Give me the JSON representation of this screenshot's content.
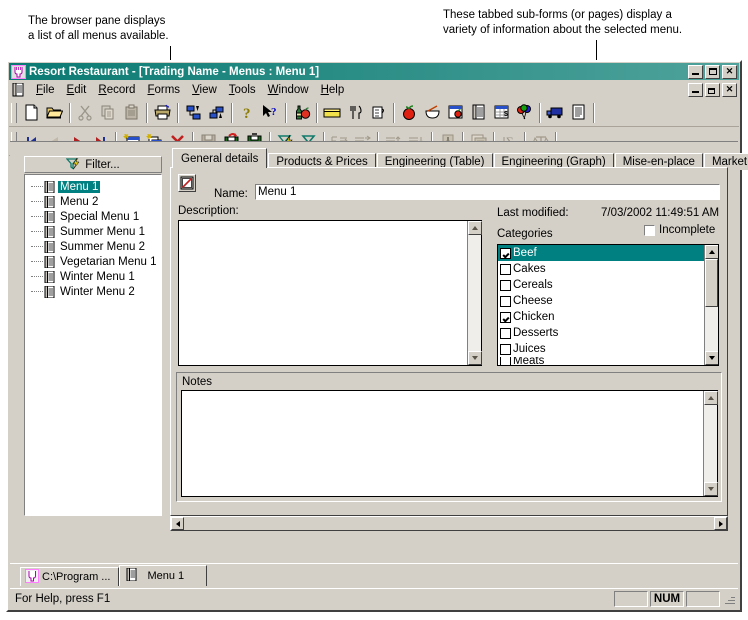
{
  "annotations": [
    {
      "text": "The browser pane displays\na list of all menus available.",
      "name": "callout-browser-pane"
    },
    {
      "text": "These tabbed sub-forms (or pages) display a\nvariety of information about the selected menu.",
      "name": "callout-tabbed-subforms"
    }
  ],
  "window": {
    "title": "Resort Restaurant - [Trading Name - Menus : Menu 1]",
    "app_icon": "restaurant-icon",
    "buttons": {
      "minimize": "_",
      "maximize": "□",
      "close": "✕"
    },
    "mdi_buttons": {
      "minimize": "_",
      "restore": "❐",
      "close": "✕"
    }
  },
  "menubar": {
    "doc_icon": "document-icon",
    "items": [
      {
        "label": "File",
        "accel": "F"
      },
      {
        "label": "Edit",
        "accel": "E"
      },
      {
        "label": "Record",
        "accel": "R"
      },
      {
        "label": "Forms",
        "accel": "F"
      },
      {
        "label": "View",
        "accel": "V"
      },
      {
        "label": "Tools",
        "accel": "T"
      },
      {
        "label": "Window",
        "accel": "W"
      },
      {
        "label": "Help",
        "accel": "H"
      }
    ]
  },
  "toolbar_row1": [
    {
      "icon": "new-document-icon",
      "enabled": true
    },
    {
      "icon": "open-folder-icon",
      "enabled": true
    },
    {
      "sep": true
    },
    {
      "icon": "cut-scissors-icon",
      "enabled": false
    },
    {
      "icon": "copy-icon",
      "enabled": false
    },
    {
      "icon": "paste-icon",
      "enabled": false
    },
    {
      "sep": true
    },
    {
      "icon": "print-icon",
      "enabled": true
    },
    {
      "sep": true
    },
    {
      "icon": "import-icon",
      "enabled": true
    },
    {
      "icon": "export-icon",
      "enabled": true
    },
    {
      "sep": true
    },
    {
      "icon": "help-question-icon",
      "enabled": true
    },
    {
      "icon": "context-help-arrow-icon",
      "enabled": true
    },
    {
      "sep": true
    },
    {
      "icon": "beverages-bottle-apple-icon",
      "enabled": true
    },
    {
      "sep": true
    },
    {
      "icon": "storage-box-icon",
      "enabled": true
    },
    {
      "icon": "cutlery-icon",
      "enabled": true
    },
    {
      "icon": "measuring-jug-icon",
      "enabled": true
    },
    {
      "sep": true
    },
    {
      "icon": "ingredient-tomato-icon",
      "enabled": true
    },
    {
      "icon": "mixing-bowl-icon",
      "enabled": true
    },
    {
      "icon": "recipe-card-icon",
      "enabled": true
    },
    {
      "icon": "menu-document-icon",
      "enabled": true
    },
    {
      "icon": "costing-sheet-icon",
      "enabled": true
    },
    {
      "icon": "function-balloons-icon",
      "enabled": true
    },
    {
      "sep": true
    },
    {
      "icon": "delivery-truck-icon",
      "enabled": true
    },
    {
      "icon": "supplier-list-icon",
      "enabled": true
    }
  ],
  "toolbar_row2": [
    {
      "icon": "first-record-icon",
      "enabled": true
    },
    {
      "icon": "previous-record-icon",
      "enabled": false
    },
    {
      "icon": "next-record-icon",
      "enabled": true
    },
    {
      "icon": "last-record-icon",
      "enabled": true
    },
    {
      "sep": true
    },
    {
      "icon": "new-record-icon",
      "enabled": true
    },
    {
      "icon": "duplicate-record-icon",
      "enabled": true
    },
    {
      "icon": "delete-record-icon",
      "enabled": true
    },
    {
      "sep": true
    },
    {
      "icon": "save-icon",
      "enabled": false
    },
    {
      "icon": "undo-save-icon",
      "enabled": true
    },
    {
      "icon": "save-close-icon",
      "enabled": true
    },
    {
      "sep": true
    },
    {
      "icon": "apply-filter-icon",
      "enabled": true
    },
    {
      "icon": "filter-icon",
      "enabled": true
    },
    {
      "sep": true
    },
    {
      "icon": "indent-left-icon",
      "enabled": false
    },
    {
      "icon": "indent-right-icon",
      "enabled": false
    },
    {
      "sep": true
    },
    {
      "icon": "move-up-icon",
      "enabled": false
    },
    {
      "icon": "move-down-icon",
      "enabled": false
    },
    {
      "sep": true
    },
    {
      "icon": "insert-down-icon",
      "enabled": false
    },
    {
      "sep": true
    },
    {
      "icon": "properties-icon",
      "enabled": false
    },
    {
      "sep": true
    },
    {
      "icon": "sum-sigma-icon",
      "enabled": false
    },
    {
      "sep": true
    },
    {
      "icon": "balance-scale-icon",
      "enabled": false
    }
  ],
  "browser": {
    "filter_label": "Filter...",
    "filter_icon": "filter-funnel-icon",
    "items": [
      {
        "label": "Menu 1",
        "selected": true
      },
      {
        "label": "Menu 2",
        "selected": false
      },
      {
        "label": "Special Menu 1",
        "selected": false
      },
      {
        "label": "Summer Menu 1",
        "selected": false
      },
      {
        "label": "Summer Menu 2",
        "selected": false
      },
      {
        "label": "Vegetarian Menu 1",
        "selected": false
      },
      {
        "label": "Winter Menu 1",
        "selected": false
      },
      {
        "label": "Winter Menu 2",
        "selected": false
      }
    ]
  },
  "form": {
    "tabs": [
      {
        "label": "General details",
        "active": true
      },
      {
        "label": "Products & Prices",
        "active": false
      },
      {
        "label": "Engineering (Table)",
        "active": false
      },
      {
        "label": "Engineering (Graph)",
        "active": false
      },
      {
        "label": "Mise-en-place",
        "active": false
      },
      {
        "label": "Market List",
        "active": false
      }
    ],
    "pick_icon": "pick-edit-icon",
    "name_label": "Name:",
    "name_value": "Menu 1",
    "description_label": "Description:",
    "description_value": "",
    "last_modified_label": "Last modified:",
    "last_modified_value": "7/03/2002 11:49:51 AM",
    "incomplete_label": "Incomplete",
    "incomplete_checked": false,
    "categories_label": "Categories",
    "categories": [
      {
        "label": "Beef",
        "checked": true,
        "selected": true
      },
      {
        "label": "Cakes",
        "checked": false,
        "selected": false
      },
      {
        "label": "Cereals",
        "checked": false,
        "selected": false
      },
      {
        "label": "Cheese",
        "checked": false,
        "selected": false
      },
      {
        "label": "Chicken",
        "checked": true,
        "selected": false
      },
      {
        "label": "Desserts",
        "checked": false,
        "selected": false
      },
      {
        "label": "Juices",
        "checked": false,
        "selected": false
      },
      {
        "label": "Meats",
        "checked": false,
        "selected": false
      }
    ],
    "notes_label": "Notes",
    "notes_value": ""
  },
  "mdi_tabs": [
    {
      "label": "C:\\Program ...",
      "icon": "restaurant-icon",
      "active": false
    },
    {
      "label": "Menu 1",
      "icon": "document-icon",
      "active": true
    }
  ],
  "statusbar": {
    "help_text": "For Help, press F1",
    "num_indicator": "NUM"
  },
  "colors": {
    "window_face": "#d4d0c8",
    "titlebar_left": "#0a7a72",
    "titlebar_right": "#4fa39c",
    "selection": "#008080",
    "selection_text": "#ffffff",
    "text": "#000000"
  }
}
